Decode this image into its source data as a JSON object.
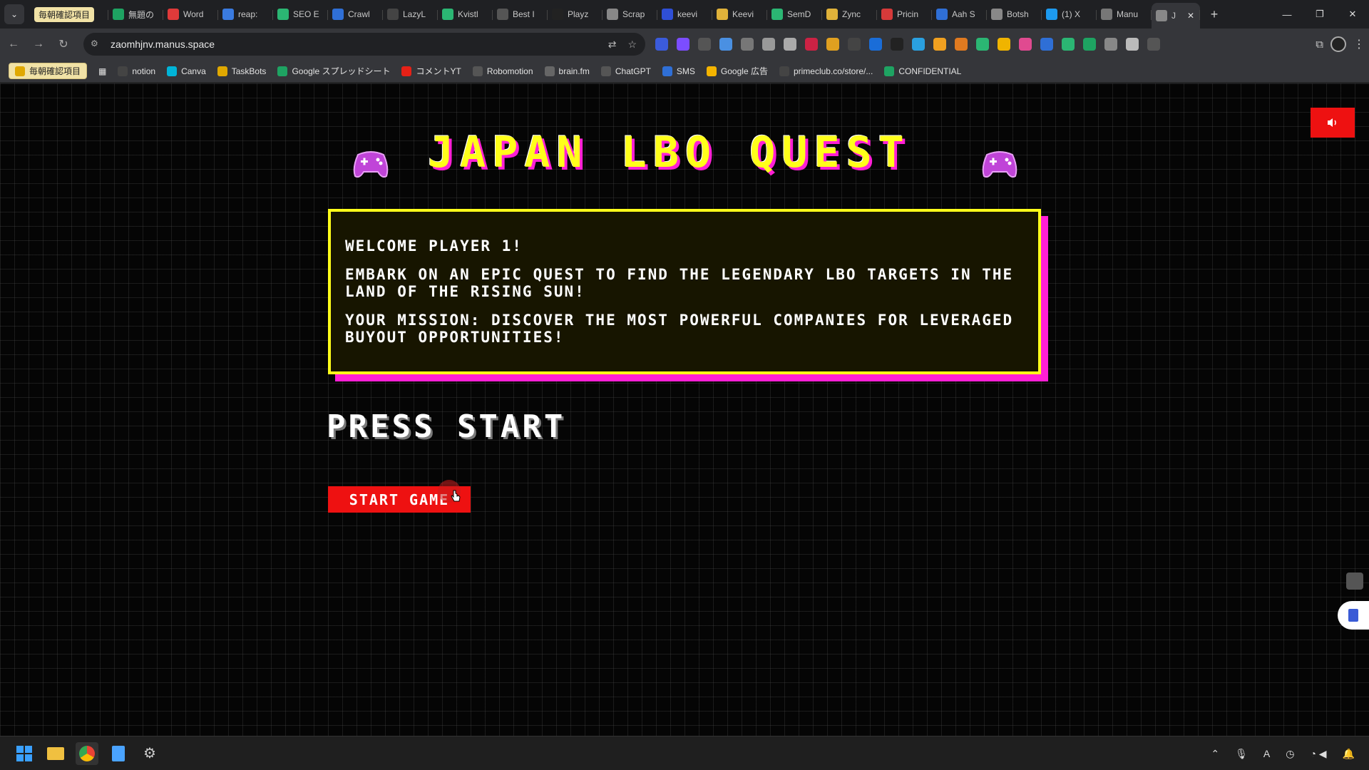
{
  "browser": {
    "tabs": [
      {
        "label": "毎朝確認項目",
        "color": "#f1e2a6",
        "icon": "folder-icon"
      },
      {
        "label": "無題の",
        "color": "#1ea362",
        "icon": "sheets-icon"
      },
      {
        "label": "Word",
        "color": "#e03a3a",
        "icon": "t-icon"
      },
      {
        "label": "reap:",
        "color": "#3a7be0",
        "icon": "b-icon"
      },
      {
        "label": "SEO E",
        "color": "#2bb673",
        "icon": "seo-icon"
      },
      {
        "label": "Crawl",
        "color": "#2f6fd6",
        "icon": "crawl-icon"
      },
      {
        "label": "LazyL",
        "color": "#444444",
        "icon": "lazy-icon"
      },
      {
        "label": "Kvistl",
        "color": "#2bb673",
        "icon": "plus-icon"
      },
      {
        "label": "Best I",
        "color": "#555555",
        "icon": "best-icon"
      },
      {
        "label": "Playz",
        "color": "#222222",
        "icon": "p-icon"
      },
      {
        "label": "Scrap",
        "color": "#888888",
        "icon": "scrap-icon"
      },
      {
        "label": "keevi",
        "color": "#2f4fd6",
        "icon": "k-icon"
      },
      {
        "label": "Keevi",
        "color": "#e0b23a",
        "icon": "keevi-icon"
      },
      {
        "label": "SemD",
        "color": "#2bb673",
        "icon": "sem-icon"
      },
      {
        "label": "Zync",
        "color": "#e0b23a",
        "icon": "zync-icon"
      },
      {
        "label": "Pricin",
        "color": "#d63a3a",
        "icon": "pricing-icon"
      },
      {
        "label": "Aah S",
        "color": "#2f6fd6",
        "icon": "s-icon"
      },
      {
        "label": "Botsh",
        "color": "#888888",
        "icon": "globe-icon"
      },
      {
        "label": "(1) X",
        "color": "#1d9bf0",
        "icon": "x-icon"
      },
      {
        "label": "Manu",
        "color": "#777777",
        "icon": "manus-icon"
      },
      {
        "label": "J",
        "color": "#888888",
        "icon": "globe-icon"
      }
    ],
    "url": "zaomhjnv.manus.space",
    "bookmarks": [
      {
        "label": "毎朝確認項目",
        "icon": "folder-icon",
        "color": "#e0a800"
      },
      {
        "label": "notion",
        "icon": "notion-icon",
        "color": "#444444"
      },
      {
        "label": "Canva",
        "icon": "canva-icon",
        "color": "#00b4d8"
      },
      {
        "label": "TaskBots",
        "icon": "taskbots-icon",
        "color": "#e0a800"
      },
      {
        "label": "Google スプレッドシート",
        "icon": "sheets-icon",
        "color": "#1ea362"
      },
      {
        "label": "コメントYT",
        "icon": "youtube-icon",
        "color": "#e62117"
      },
      {
        "label": "Robomotion",
        "icon": "robomotion-icon",
        "color": "#555555"
      },
      {
        "label": "brain.fm",
        "icon": "brainfm-icon",
        "color": "#666666"
      },
      {
        "label": "ChatGPT",
        "icon": "chatgpt-icon",
        "color": "#555555"
      },
      {
        "label": "SMS",
        "icon": "sms-icon",
        "color": "#2f6fd6"
      },
      {
        "label": "Google 広告",
        "icon": "google-ads-icon",
        "color": "#f4b400"
      },
      {
        "label": "primeclub.co/store/...",
        "icon": "primeclub-icon",
        "color": "#444444"
      },
      {
        "label": "CONFIDENTIAL",
        "icon": "sheets-icon",
        "color": "#1ea362"
      }
    ]
  },
  "game": {
    "title": "JAPAN LBO QUEST",
    "welcome_lines": [
      "WELCOME PLAYER 1!",
      "EMBARK ON AN EPIC QUEST TO FIND THE LEGENDARY LBO TARGETS IN THE LAND OF THE RISING SUN!",
      "YOUR MISSION: DISCOVER THE MOST POWERFUL COMPANIES FOR LEVERAGED BUYOUT OPPORTUNITIES!"
    ],
    "press_start": "PRESS START",
    "start_button": "START GAME",
    "colors": {
      "title": "#ffff1a",
      "shadow": "#ff1fd5",
      "button": "#ee1111"
    }
  }
}
